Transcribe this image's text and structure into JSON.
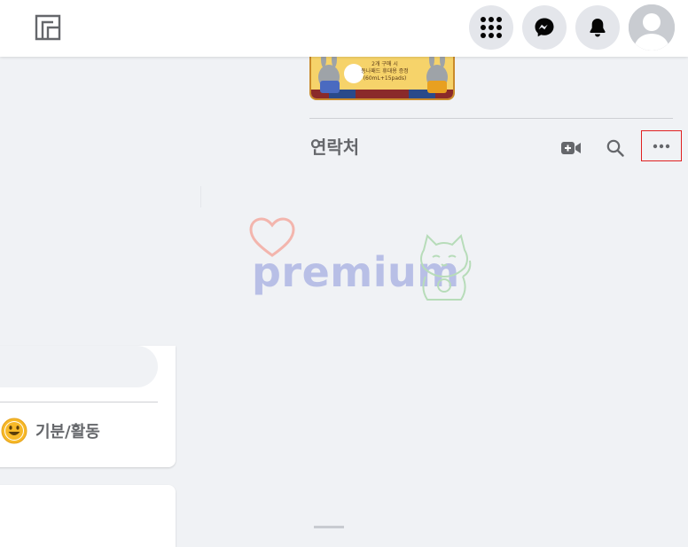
{
  "topbar": {
    "icons": [
      "gaming-logo-icon",
      "apps-grid-icon",
      "messenger-icon",
      "notifications-bell-icon",
      "profile-avatar"
    ]
  },
  "ad": {
    "lines": [
      "2개 구매 시",
      "동나패드 휴대용 증정",
      "(60mL+15pads)"
    ]
  },
  "contacts": {
    "title": "연락처",
    "icons": [
      "new-room-video-icon",
      "search-icon",
      "more-options-icon"
    ]
  },
  "composer": {
    "feeling_label": "기분/활동"
  },
  "watermark": {
    "text": "premium"
  },
  "colors": {
    "background": "#f0f2f5",
    "card": "#ffffff",
    "icon_button_bg": "#e4e6eb",
    "secondary_text": "#65676b",
    "highlight_border": "#e02020",
    "emoji_yellow": "#f7b928"
  }
}
